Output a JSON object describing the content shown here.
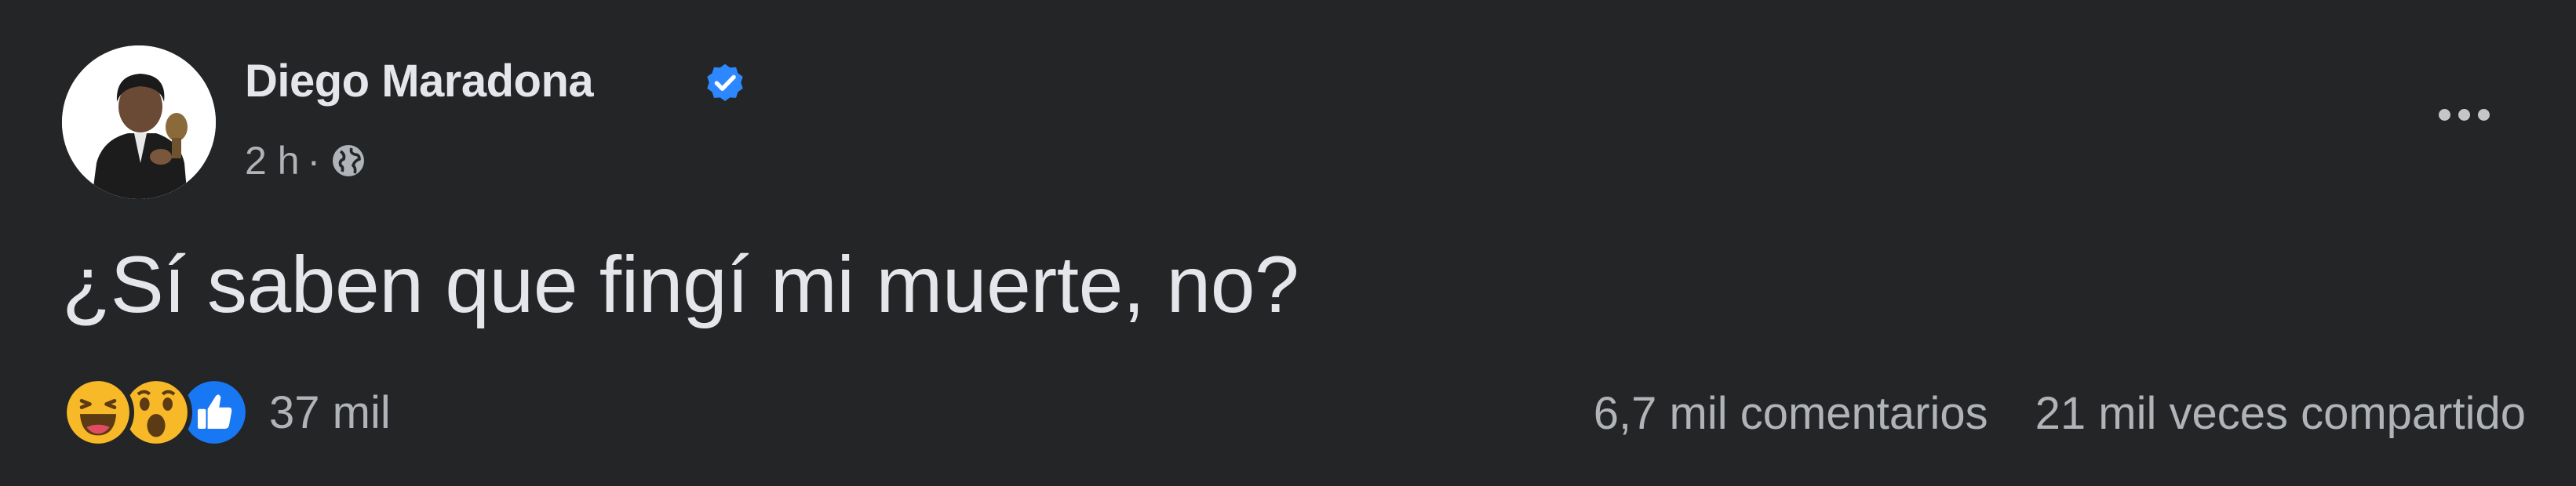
{
  "post": {
    "author": "Diego Maradona",
    "verified": true,
    "timestamp": "2 h",
    "separator": "·",
    "audience_icon": "globe-icon",
    "text": "¿Sí saben que fingí mi muerte, no?",
    "more_icon": "more-horizontal-icon"
  },
  "reactions": {
    "icons": [
      "haha-icon",
      "wow-icon",
      "like-icon"
    ],
    "count": "37 mil"
  },
  "engagement": {
    "comments": "6,7 mil comentarios",
    "shares": "21 mil veces compartido"
  },
  "colors": {
    "background": "#242526",
    "text_primary": "#e4e6eb",
    "text_secondary": "#b0b3b8",
    "verified_blue": "#2d88ff",
    "like_blue": "#1877f2",
    "emoji_yellow": "#f7b928"
  }
}
